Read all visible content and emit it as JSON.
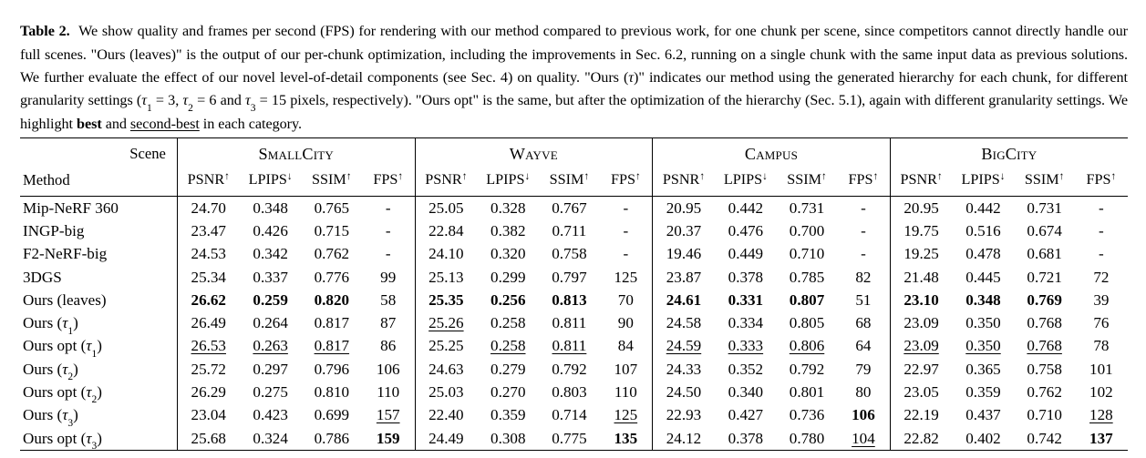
{
  "caption": {
    "label": "Table 2.",
    "text_part1": "We show quality and frames per second (FPS) for rendering with our method compared to previous work, for one chunk per scene, since competitors cannot directly handle our full scenes. \"Ours (leaves)\" is the output of our per-chunk optimization, including the improvements in Sec. 6.2, running on a single chunk with the same input data as previous solutions. We further evaluate the effect of our novel level-of-detail components (see Sec. 4) on quality. \"Ours (",
    "tau1": "τ",
    "text_part2": ")\" indicates our method using the generated hierarchy for each chunk, for different granularity settings (",
    "tau_settings": "τ1 = 3, τ2 = 6 and τ3 = 15 pixels, respectively",
    "text_part3": "). \"Ours opt\" is the same, but after the optimization of the hierarchy (Sec. 5.1), again with different granularity settings. We highlight ",
    "best_word": "best",
    "text_part4": " and ",
    "second_best_word": "second-best",
    "text_part5": " in each category."
  },
  "table": {
    "corner_top_label": "Scene",
    "corner_bottom_label": "Method",
    "scenes": [
      "SmallCity",
      "Wayve",
      "Campus",
      "BigCity"
    ],
    "metrics": [
      {
        "name": "PSNR",
        "arrow": "↑"
      },
      {
        "name": "LPIPS",
        "arrow": "↓"
      },
      {
        "name": "SSIM",
        "arrow": "↑"
      },
      {
        "name": "FPS",
        "arrow": "↑"
      }
    ],
    "rows": [
      {
        "method": "Mip-NeRF 360",
        "cells": [
          {
            "v": "24.70"
          },
          {
            "v": "0.348"
          },
          {
            "v": "0.765"
          },
          {
            "v": "-"
          },
          {
            "v": "25.05"
          },
          {
            "v": "0.328"
          },
          {
            "v": "0.767"
          },
          {
            "v": "-"
          },
          {
            "v": "20.95"
          },
          {
            "v": "0.442"
          },
          {
            "v": "0.731"
          },
          {
            "v": "-"
          },
          {
            "v": "20.95"
          },
          {
            "v": "0.442"
          },
          {
            "v": "0.731"
          },
          {
            "v": "-"
          }
        ]
      },
      {
        "method": "INGP-big",
        "cells": [
          {
            "v": "23.47"
          },
          {
            "v": "0.426"
          },
          {
            "v": "0.715"
          },
          {
            "v": "-"
          },
          {
            "v": "22.84"
          },
          {
            "v": "0.382"
          },
          {
            "v": "0.711"
          },
          {
            "v": "-"
          },
          {
            "v": "20.37"
          },
          {
            "v": "0.476"
          },
          {
            "v": "0.700"
          },
          {
            "v": "-"
          },
          {
            "v": "19.75"
          },
          {
            "v": "0.516"
          },
          {
            "v": "0.674"
          },
          {
            "v": "-"
          }
        ]
      },
      {
        "method": "F2-NeRF-big",
        "cells": [
          {
            "v": "24.53"
          },
          {
            "v": "0.342"
          },
          {
            "v": "0.762"
          },
          {
            "v": "-"
          },
          {
            "v": "24.10"
          },
          {
            "v": "0.320"
          },
          {
            "v": "0.758"
          },
          {
            "v": "-"
          },
          {
            "v": "19.46"
          },
          {
            "v": "0.449"
          },
          {
            "v": "0.710"
          },
          {
            "v": "-"
          },
          {
            "v": "19.25"
          },
          {
            "v": "0.478"
          },
          {
            "v": "0.681"
          },
          {
            "v": "-"
          }
        ]
      },
      {
        "method": "3DGS",
        "cells": [
          {
            "v": "25.34"
          },
          {
            "v": "0.337"
          },
          {
            "v": "0.776"
          },
          {
            "v": "99"
          },
          {
            "v": "25.13"
          },
          {
            "v": "0.299"
          },
          {
            "v": "0.797"
          },
          {
            "v": "125"
          },
          {
            "v": "23.87"
          },
          {
            "v": "0.378"
          },
          {
            "v": "0.785"
          },
          {
            "v": "82"
          },
          {
            "v": "21.48"
          },
          {
            "v": "0.445"
          },
          {
            "v": "0.721"
          },
          {
            "v": "72"
          }
        ]
      },
      {
        "method": "Ours (leaves)",
        "cells": [
          {
            "v": "26.62",
            "s": "b"
          },
          {
            "v": "0.259",
            "s": "b"
          },
          {
            "v": "0.820",
            "s": "b"
          },
          {
            "v": "58"
          },
          {
            "v": "25.35",
            "s": "b"
          },
          {
            "v": "0.256",
            "s": "b"
          },
          {
            "v": "0.813",
            "s": "b"
          },
          {
            "v": "70"
          },
          {
            "v": "24.61",
            "s": "b"
          },
          {
            "v": "0.331",
            "s": "b"
          },
          {
            "v": "0.807",
            "s": "b"
          },
          {
            "v": "51"
          },
          {
            "v": "23.10",
            "s": "b"
          },
          {
            "v": "0.348",
            "s": "b"
          },
          {
            "v": "0.769",
            "s": "b"
          },
          {
            "v": "39"
          }
        ]
      },
      {
        "method": "Ours (τ1)",
        "method_base": "Ours (",
        "method_tau": "τ",
        "method_sub": "1",
        "method_tail": ")",
        "cells": [
          {
            "v": "26.49"
          },
          {
            "v": "0.264"
          },
          {
            "v": "0.817"
          },
          {
            "v": "87"
          },
          {
            "v": "25.26",
            "s": "u"
          },
          {
            "v": "0.258"
          },
          {
            "v": "0.811"
          },
          {
            "v": "90"
          },
          {
            "v": "24.58"
          },
          {
            "v": "0.334"
          },
          {
            "v": "0.805"
          },
          {
            "v": "68"
          },
          {
            "v": "23.09"
          },
          {
            "v": "0.350"
          },
          {
            "v": "0.768"
          },
          {
            "v": "76"
          }
        ]
      },
      {
        "method": "Ours opt (τ1)",
        "method_base": "Ours opt (",
        "method_tau": "τ",
        "method_sub": "1",
        "method_tail": ")",
        "cells": [
          {
            "v": "26.53",
            "s": "u"
          },
          {
            "v": "0.263",
            "s": "u"
          },
          {
            "v": "0.817",
            "s": "u"
          },
          {
            "v": "86"
          },
          {
            "v": "25.25"
          },
          {
            "v": "0.258",
            "s": "u"
          },
          {
            "v": "0.811",
            "s": "u"
          },
          {
            "v": "84"
          },
          {
            "v": "24.59",
            "s": "u"
          },
          {
            "v": "0.333",
            "s": "u"
          },
          {
            "v": "0.806",
            "s": "u"
          },
          {
            "v": "64"
          },
          {
            "v": "23.09",
            "s": "u"
          },
          {
            "v": "0.350",
            "s": "u"
          },
          {
            "v": "0.768",
            "s": "u"
          },
          {
            "v": "78"
          }
        ]
      },
      {
        "method": "Ours (τ2)",
        "method_base": "Ours (",
        "method_tau": "τ",
        "method_sub": "2",
        "method_tail": ")",
        "cells": [
          {
            "v": "25.72"
          },
          {
            "v": "0.297"
          },
          {
            "v": "0.796"
          },
          {
            "v": "106"
          },
          {
            "v": "24.63"
          },
          {
            "v": "0.279"
          },
          {
            "v": "0.792"
          },
          {
            "v": "107"
          },
          {
            "v": "24.33"
          },
          {
            "v": "0.352"
          },
          {
            "v": "0.792"
          },
          {
            "v": "79"
          },
          {
            "v": "22.97"
          },
          {
            "v": "0.365"
          },
          {
            "v": "0.758"
          },
          {
            "v": "101"
          }
        ]
      },
      {
        "method": "Ours opt (τ2)",
        "method_base": "Ours opt (",
        "method_tau": "τ",
        "method_sub": "2",
        "method_tail": ")",
        "cells": [
          {
            "v": "26.29"
          },
          {
            "v": "0.275"
          },
          {
            "v": "0.810"
          },
          {
            "v": "110"
          },
          {
            "v": "25.03"
          },
          {
            "v": "0.270"
          },
          {
            "v": "0.803"
          },
          {
            "v": "110"
          },
          {
            "v": "24.50"
          },
          {
            "v": "0.340"
          },
          {
            "v": "0.801"
          },
          {
            "v": "80"
          },
          {
            "v": "23.05"
          },
          {
            "v": "0.359"
          },
          {
            "v": "0.762"
          },
          {
            "v": "102"
          }
        ]
      },
      {
        "method": "Ours (τ3)",
        "method_base": "Ours (",
        "method_tau": "τ",
        "method_sub": "3",
        "method_tail": ")",
        "cells": [
          {
            "v": "23.04"
          },
          {
            "v": "0.423"
          },
          {
            "v": "0.699"
          },
          {
            "v": "157",
            "s": "u"
          },
          {
            "v": "22.40"
          },
          {
            "v": "0.359"
          },
          {
            "v": "0.714"
          },
          {
            "v": "125",
            "s": "u"
          },
          {
            "v": "22.93"
          },
          {
            "v": "0.427"
          },
          {
            "v": "0.736"
          },
          {
            "v": "106",
            "s": "b"
          },
          {
            "v": "22.19"
          },
          {
            "v": "0.437"
          },
          {
            "v": "0.710"
          },
          {
            "v": "128",
            "s": "u"
          }
        ]
      },
      {
        "method": "Ours opt (τ3)",
        "method_base": "Ours opt (",
        "method_tau": "τ",
        "method_sub": "3",
        "method_tail": ")",
        "cells": [
          {
            "v": "25.68"
          },
          {
            "v": "0.324"
          },
          {
            "v": "0.786"
          },
          {
            "v": "159",
            "s": "b"
          },
          {
            "v": "24.49"
          },
          {
            "v": "0.308"
          },
          {
            "v": "0.775"
          },
          {
            "v": "135",
            "s": "b"
          },
          {
            "v": "24.12"
          },
          {
            "v": "0.378"
          },
          {
            "v": "0.780"
          },
          {
            "v": "104",
            "s": "u"
          },
          {
            "v": "22.82"
          },
          {
            "v": "0.402"
          },
          {
            "v": "0.742"
          },
          {
            "v": "137",
            "s": "b"
          }
        ]
      }
    ]
  }
}
